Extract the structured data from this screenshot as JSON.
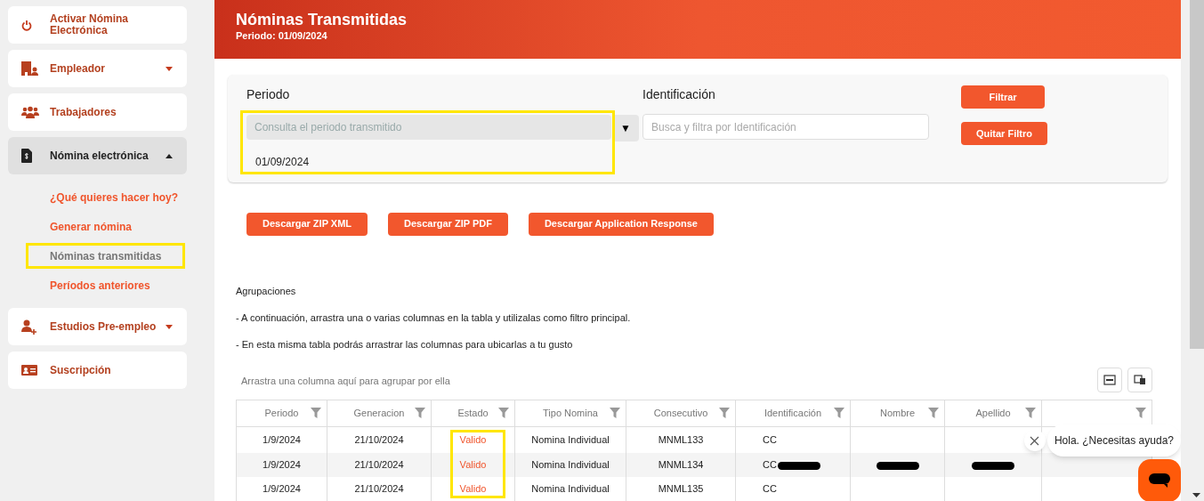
{
  "sidebar": {
    "items": [
      {
        "label": "Activar Nómina Electrónica",
        "selected": false
      },
      {
        "label": "Empleador",
        "selected": false,
        "expanded": false
      },
      {
        "label": "Trabajadores",
        "selected": false
      },
      {
        "label": "Nómina electrónica",
        "selected": true,
        "expanded": true,
        "children": [
          {
            "label": "¿Qué quieres hacer hoy?",
            "selected": false,
            "highlighted": false
          },
          {
            "label": "Generar nómina",
            "selected": false,
            "highlighted": false
          },
          {
            "label": "Nóminas transmitidas",
            "selected": true,
            "highlighted": true
          },
          {
            "label": "Períodos anteriores",
            "selected": false,
            "highlighted": false
          }
        ]
      },
      {
        "label": "Estudios Pre-empleo",
        "selected": false,
        "expanded": false
      },
      {
        "label": "Suscripción",
        "selected": false
      }
    ]
  },
  "header": {
    "title": "Nóminas Transmitidas",
    "subtitle": "Periodo: 01/09/2024"
  },
  "filters": {
    "periodo": {
      "label": "Periodo",
      "placeholder": "Consulta el periodo transmitido",
      "caret": "▼",
      "highlighted": true,
      "options": [
        "01/09/2024"
      ]
    },
    "identificacion": {
      "label": "Identificación",
      "placeholder": "Busca y filtra por Identificación"
    },
    "buttons": [
      "Filtrar",
      "Quitar Filtro"
    ]
  },
  "downloads": [
    "Descargar ZIP XML",
    "Descargar ZIP PDF",
    "Descargar Application Response"
  ],
  "notes": [
    "Agrupaciones",
    "- A continuación, arrastra una o varias columnas en la tabla y utilizalas como filtro principal.",
    "- En esta misma tabla podrás arrastrar las columnas para ubicarlas a tu gusto"
  ],
  "table": {
    "group_hint": "Arrastra una columna aquí para agrupar por ella",
    "columns": [
      {
        "label": "Periodo"
      },
      {
        "label": "Generacion"
      },
      {
        "label": "Estado"
      },
      {
        "label": "Tipo Nomina"
      },
      {
        "label": "Consecutivo"
      },
      {
        "label": "Identificación"
      },
      {
        "label": "Nombre"
      },
      {
        "label": "Apellido"
      },
      {}
    ],
    "rows": [
      {
        "cells": [
          {
            "text": "1/9/2024"
          },
          {
            "text": "21/10/2024"
          },
          {
            "text": "Valido",
            "kind": "status",
            "highlighted": true
          },
          {
            "text": "Nomina Individual"
          },
          {
            "text": "MNML133"
          },
          {
            "text": "CC"
          },
          {},
          {},
          {}
        ]
      },
      {
        "cells": [
          {
            "text": "1/9/2024"
          },
          {
            "text": "21/10/2024"
          },
          {
            "text": "Valido",
            "kind": "status",
            "highlighted": true
          },
          {
            "text": "Nomina Individual"
          },
          {
            "text": "MNML134"
          },
          {
            "text": "CC",
            "redacted": true
          },
          {
            "redacted": true
          },
          {
            "redacted": true
          },
          {}
        ]
      },
      {
        "cells": [
          {
            "text": "1/9/2024"
          },
          {
            "text": "21/10/2024"
          },
          {
            "text": "Valido",
            "kind": "status",
            "highlighted": true
          },
          {
            "text": "Nomina Individual"
          },
          {
            "text": "MNML135"
          },
          {
            "text": "CC"
          },
          {},
          {},
          {}
        ]
      }
    ]
  },
  "chat": {
    "message": "Hola. ¿Necesitas ayuda?"
  }
}
